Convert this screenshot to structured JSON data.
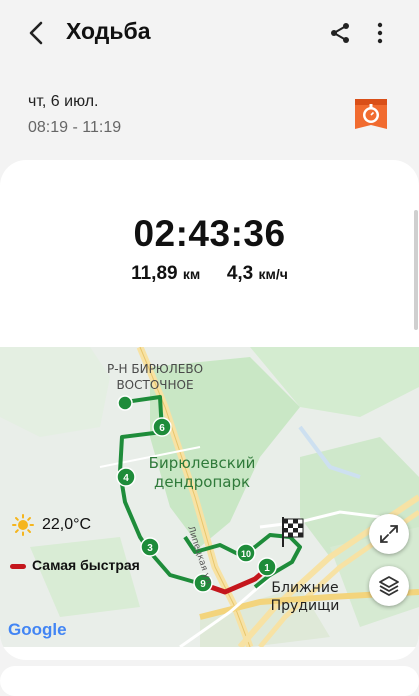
{
  "header": {
    "title": "Ходьба"
  },
  "workout": {
    "date": "чт, 6 июл.",
    "time_range": "08:19 - 11:19",
    "duration": "02:43:36",
    "distance_value": "11,89",
    "distance_unit": "км",
    "speed_value": "4,3",
    "speed_unit": "км/ч"
  },
  "map": {
    "temperature": "22,0°C",
    "legend_fastest": "Самая быстрая",
    "district_line1": "Р-Н БИРЮЛЕВО",
    "district_line2": "ВОСТОЧНОЕ",
    "park_line1": "Бирюлевский",
    "park_line2": "дендропарк",
    "village_line1": "Ближние",
    "village_line2": "Прудищи",
    "street": "Липецкая ул.",
    "google": "Google",
    "markers": [
      "1",
      "3",
      "4",
      "6",
      "9",
      "10"
    ],
    "route_color": "#1e8c3a",
    "fastest_color": "#c4161c"
  },
  "icons": {
    "back": "back-arrow-icon",
    "share": "share-icon",
    "more": "more-vert-icon",
    "badge": "workout-badge-icon",
    "weather": "sun-icon",
    "fullscreen": "expand-icon",
    "layers": "layers-icon",
    "finish": "checkered-flag-icon"
  }
}
